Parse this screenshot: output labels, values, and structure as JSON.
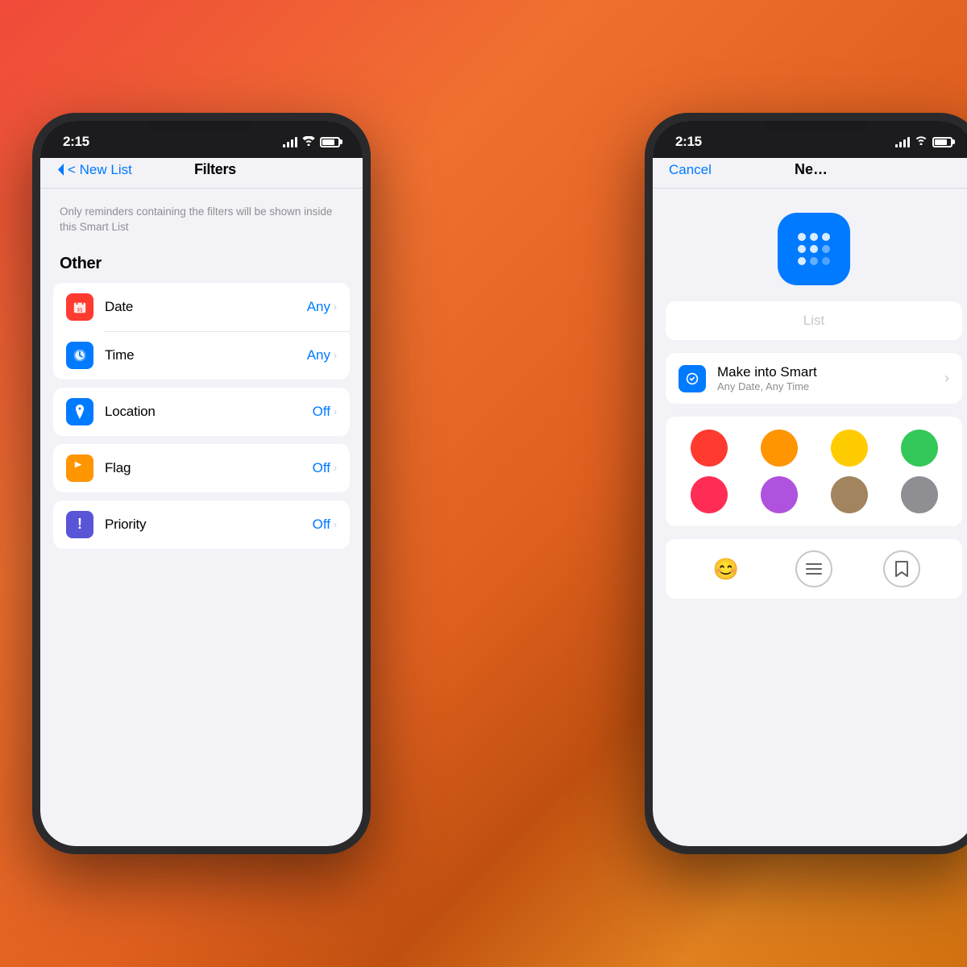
{
  "background": {
    "gradient": "coral-to-orange"
  },
  "phone_left": {
    "status_bar": {
      "time": "2:15",
      "location_icon": "▷"
    },
    "nav": {
      "back_label": "< New List",
      "title": "Filters",
      "right_label": ""
    },
    "subtitle": "Only reminders containing the filters will be shown inside this Smart List",
    "section_header": "Other",
    "filter_groups": {
      "group1": {
        "items": [
          {
            "icon_bg": "red",
            "icon": "📅",
            "label": "Date",
            "value": "Any"
          },
          {
            "icon_bg": "blue",
            "icon": "🕐",
            "label": "Time",
            "value": "Any"
          }
        ]
      },
      "group2": {
        "items": [
          {
            "icon_bg": "blue",
            "icon": "→",
            "label": "Location",
            "value": "Off"
          }
        ]
      },
      "group3": {
        "items": [
          {
            "icon_bg": "orange",
            "icon": "⚑",
            "label": "Flag",
            "value": "Off"
          }
        ]
      },
      "group4": {
        "items": [
          {
            "icon_bg": "purple",
            "icon": "!",
            "label": "Priority",
            "value": "Off"
          }
        ]
      }
    }
  },
  "phone_right": {
    "status_bar": {
      "time": "2:15"
    },
    "nav": {
      "cancel_label": "Cancel",
      "title": "Ne…"
    },
    "icon_preview": {
      "bg_color": "#007AFF"
    },
    "list_name_placeholder": "List",
    "smart_list": {
      "label": "Make into Smart",
      "subtitle": "Any Date, Any Time"
    },
    "colors": [
      "#ff3b30",
      "#ff9500",
      "#ffcc02",
      "#34c759",
      "#ff2d55",
      "#af52de",
      "#a2845e",
      "#8e8e93"
    ],
    "icons": [
      {
        "type": "emoji",
        "value": "😊"
      },
      {
        "type": "outlined",
        "value": "≡"
      },
      {
        "type": "outlined",
        "value": "🔖"
      }
    ]
  }
}
